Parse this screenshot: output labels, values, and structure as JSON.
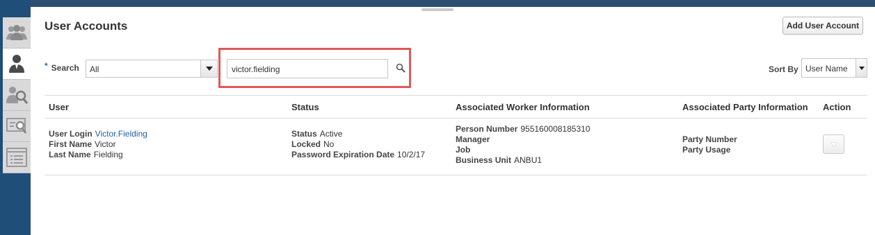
{
  "page": {
    "title": "User Accounts",
    "add_button": "Add User Account"
  },
  "rail": {
    "items": [
      {
        "icon": "users-group-icon",
        "active": false
      },
      {
        "icon": "user-icon",
        "active": true
      },
      {
        "icon": "user-search-icon",
        "active": false
      },
      {
        "icon": "card-search-icon",
        "active": false
      },
      {
        "icon": "list-icon",
        "active": false
      }
    ]
  },
  "search": {
    "required_marker": "*",
    "label": "Search",
    "scope_value": "All",
    "query_value": "victor.fielding"
  },
  "sort": {
    "label": "Sort By",
    "value": "User Name"
  },
  "table": {
    "headers": {
      "user": "User",
      "status": "Status",
      "worker": "Associated Worker Information",
      "party": "Associated Party Information",
      "action": "Action"
    },
    "rows": [
      {
        "user": {
          "login_label": "User Login",
          "login_value": "Victor.Fielding",
          "first_label": "First Name",
          "first_value": "Victor",
          "last_label": "Last Name",
          "last_value": "Fielding"
        },
        "status": {
          "status_label": "Status",
          "status_value": "Active",
          "locked_label": "Locked",
          "locked_value": "No",
          "expiry_label": "Password Expiration Date",
          "expiry_value": "10/2/17"
        },
        "worker": {
          "person_label": "Person Number",
          "person_value": "955160008185310",
          "manager_label": "Manager",
          "job_label": "Job",
          "bu_label": "Business Unit",
          "bu_value": "ANBU1"
        },
        "party": {
          "number_label": "Party Number",
          "usage_label": "Party Usage"
        }
      }
    ]
  },
  "colors": {
    "highlight": "#e05858",
    "link": "#1f5fa8",
    "rail": "#1f4e79"
  }
}
